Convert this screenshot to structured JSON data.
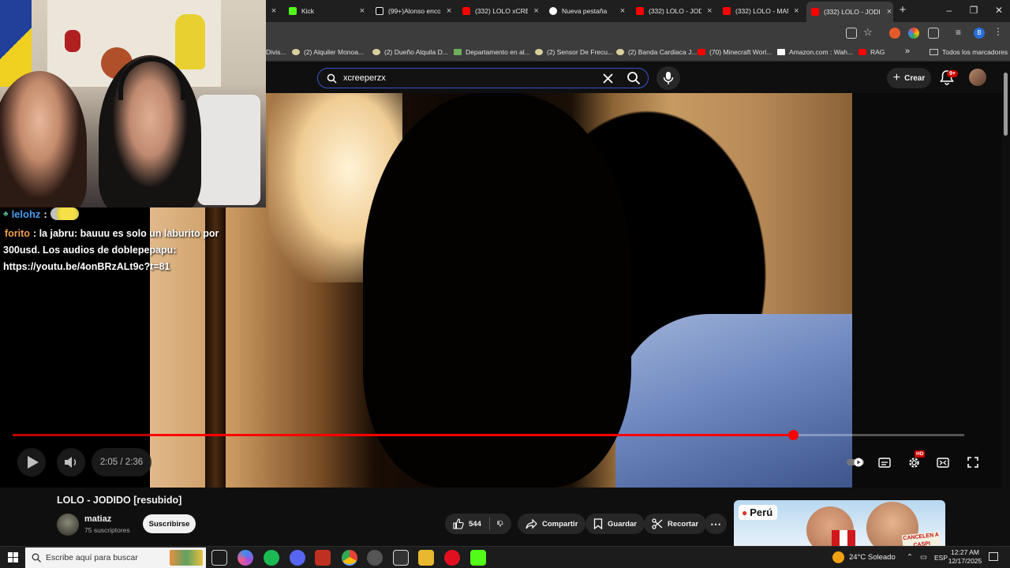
{
  "browser": {
    "tabs": [
      {
        "title": "",
        "color": "#5a5a5a"
      },
      {
        "title": "Kick",
        "color": "#53fc18"
      },
      {
        "title": "(99+)Alonso enco",
        "color": "#111111"
      },
      {
        "title": "(332) LOLO xCREE",
        "color": "#ff0000"
      },
      {
        "title": "Nueva pestaña",
        "color": "#ffffff"
      },
      {
        "title": "(332) LOLO - JODI",
        "color": "#ff0000"
      },
      {
        "title": "(332) LOLO - MAN",
        "color": "#ff0000"
      },
      {
        "title": "(332) LOLO - JODI",
        "color": "#ff0000"
      }
    ],
    "new_tab": "+",
    "bookmarks": [
      "Divis...",
      "(2) Alquiler Monoa...",
      "(2) Dueño Alquila D...",
      "Departamento en al...",
      "(2) Sensor De Frecu...",
      "(2) Banda Cardiaca J...",
      "(70) Minecraft Worl...",
      "Amazon.com : Wah...",
      "RAG"
    ],
    "bookmarks_more": "»",
    "all_bookmarks": "Todos los marcadores",
    "profile_initial": "B"
  },
  "youtube": {
    "search_query": "xcreeperzx",
    "create_label": "Crear",
    "notif_count": "9+"
  },
  "chat": {
    "user1": "lelohz",
    "user2": "forito",
    "sep": ":",
    "line1": " la jabru: bauuu es solo un laburito por",
    "line2": "300usd. Los audios de doblepepapu:",
    "line3": "https://youtu.be/4onBRzALt9c?t=81"
  },
  "player": {
    "time": "2:05 / 2:36",
    "progress_fraction": 0.82,
    "hd_badge": "HD"
  },
  "video": {
    "title": "LOLO - JODIDO [resubido]",
    "channel": "matiaz",
    "subscribers": "75 suscriptores",
    "subscribe_label": "Suscribirse",
    "likes": "544",
    "share_label": "Compartir",
    "save_label": "Guardar",
    "clip_label": "Recortar"
  },
  "ad": {
    "location_label": "Perú",
    "sign_text": "CANCELEN A CASPI"
  },
  "taskbar": {
    "search_placeholder": "Escribe aquí para buscar",
    "weather": "24°C  Soleado",
    "language": "ESP",
    "time": "12:27 AM",
    "date": "12/17/2025"
  }
}
